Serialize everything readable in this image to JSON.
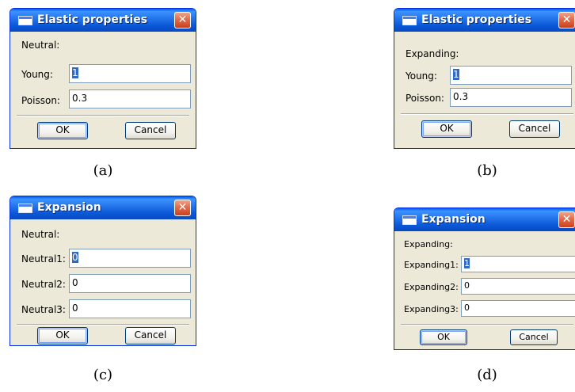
{
  "panels": {
    "a": {
      "title": "Elastic properties",
      "close_label": "✕",
      "section_label": "Neutral:",
      "fields": [
        {
          "label": "Young:",
          "value": "1"
        },
        {
          "label": "Poisson:",
          "value": "0.3"
        }
      ],
      "ok_label": "OK",
      "cancel_label": "Cancel",
      "caption": "(a)"
    },
    "b": {
      "title": "Elastic properties",
      "close_label": "✕",
      "section_label": "Expanding:",
      "fields": [
        {
          "label": "Young:",
          "value": "1"
        },
        {
          "label": "Poisson:",
          "value": "0.3"
        }
      ],
      "ok_label": "OK",
      "cancel_label": "Cancel",
      "caption": "(b)"
    },
    "c": {
      "title": "Expansion",
      "close_label": "✕",
      "section_label": "Neutral:",
      "fields": [
        {
          "label": "Neutral1:",
          "value": "0"
        },
        {
          "label": "Neutral2:",
          "value": "0"
        },
        {
          "label": "Neutral3:",
          "value": "0"
        }
      ],
      "ok_label": "OK",
      "cancel_label": "Cancel",
      "caption": "(c)"
    },
    "d": {
      "title": "Expansion",
      "close_label": "✕",
      "section_label": "Expanding:",
      "fields": [
        {
          "label": "Expanding1:",
          "value": "1"
        },
        {
          "label": "Expanding2:",
          "value": "0"
        },
        {
          "label": "Expanding3:",
          "value": "0"
        }
      ],
      "ok_label": "OK",
      "cancel_label": "Cancel",
      "caption": "(d)"
    }
  },
  "colors": {
    "titlebar": "#0a57d6",
    "dialog_bg": "#ece9d8",
    "close_button": "#e26c4a",
    "selection": "#316ac5"
  },
  "icons": {
    "window": "window-icon",
    "close": "close-icon"
  }
}
